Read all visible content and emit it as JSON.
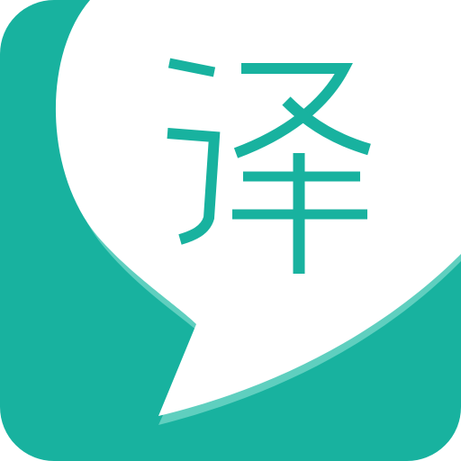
{
  "app_icon": {
    "glyph": "译",
    "colors": {
      "tile": "#18b29f",
      "bubble": "#ffffff",
      "bubble_shadow": "#5fcfbf",
      "glyph": "#18b29f"
    },
    "icon_name": "speech-bubble-translate-icon"
  }
}
